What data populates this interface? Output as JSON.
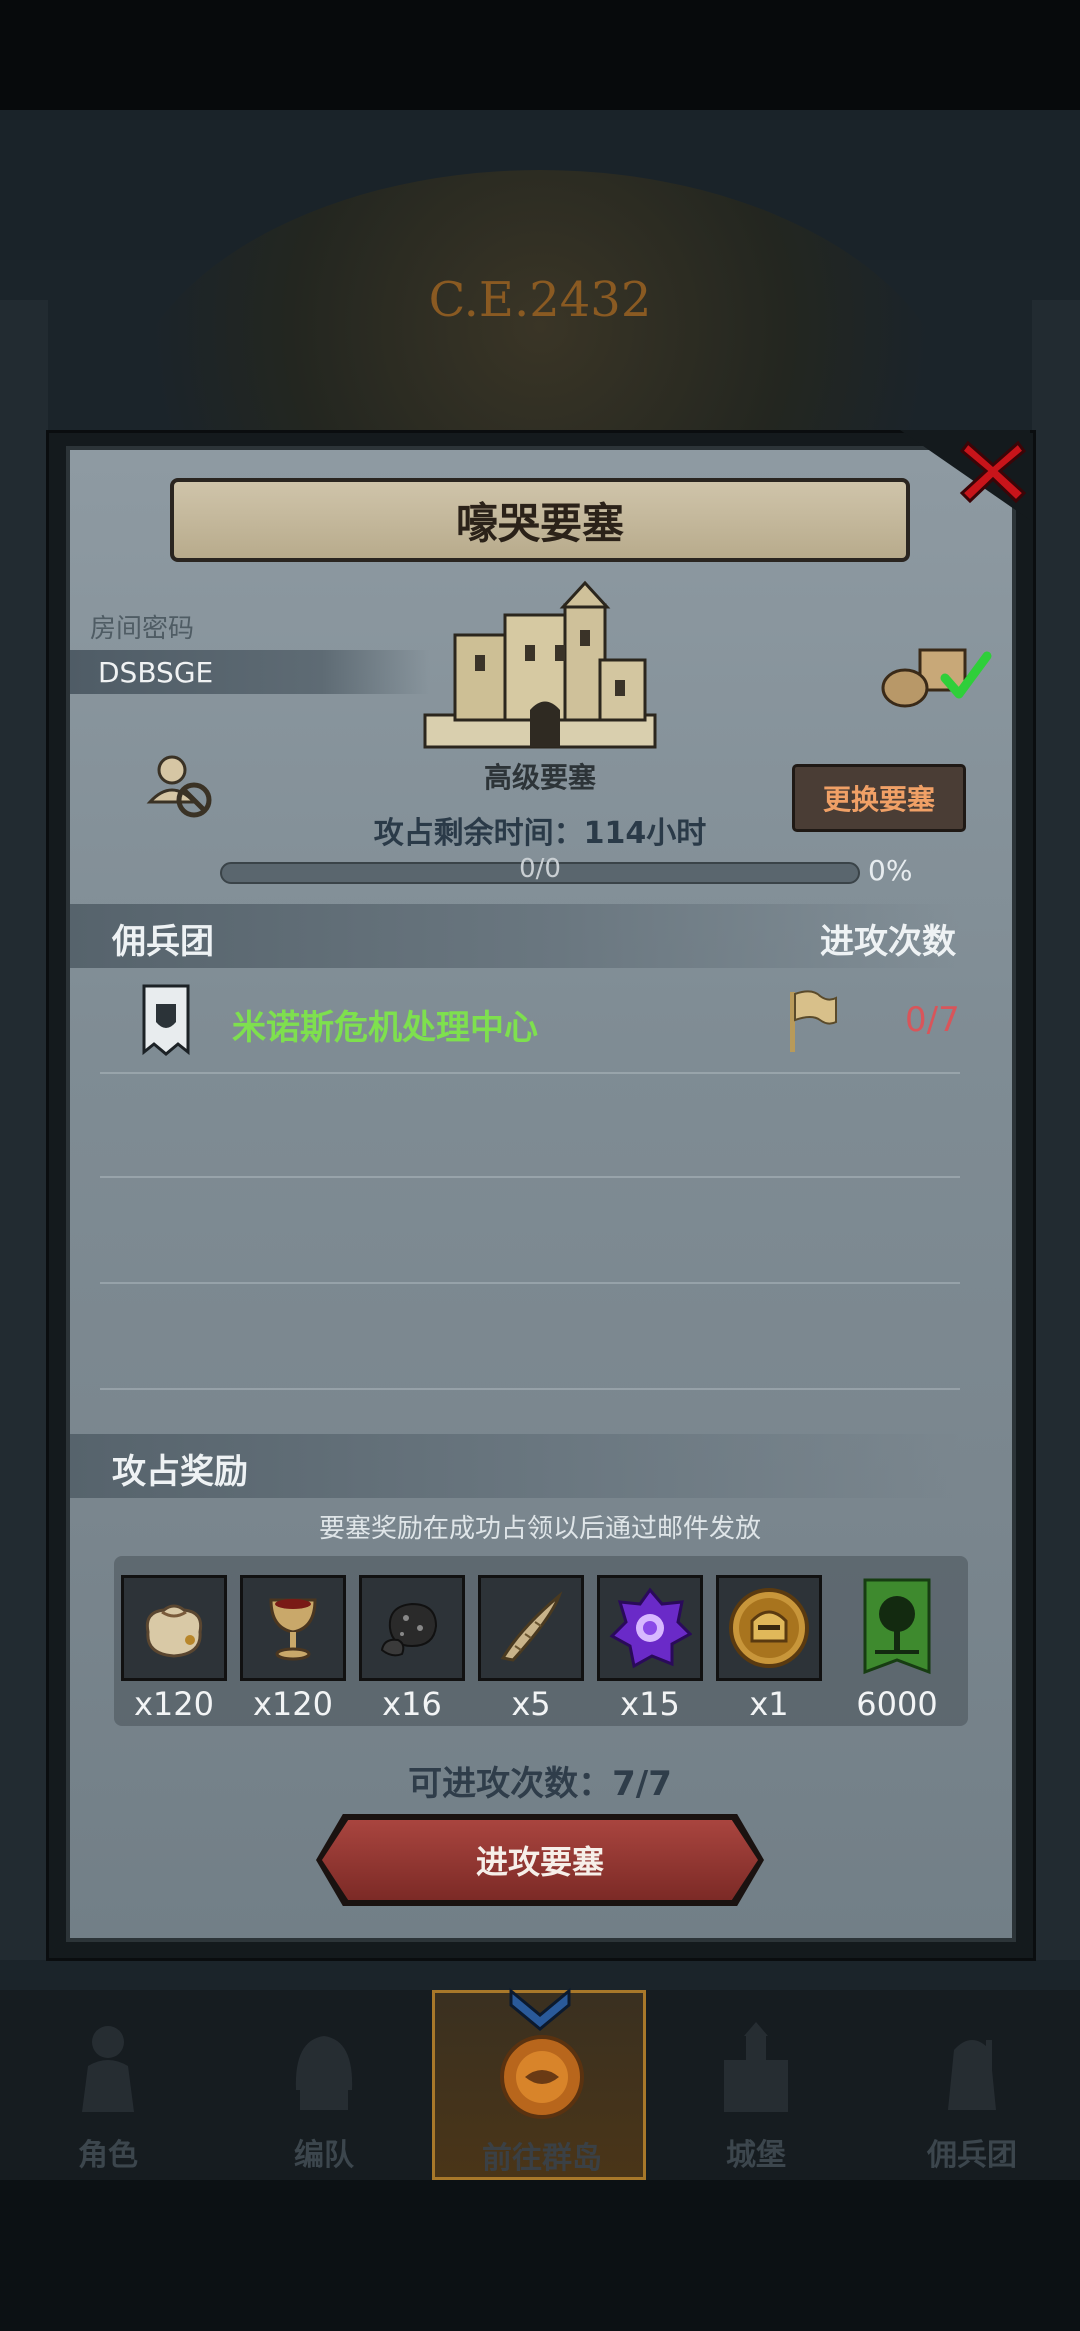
{
  "background": {
    "era_text": "C.E.2432"
  },
  "dialog": {
    "title": "嚎哭要塞",
    "room_password_label": "房间密码",
    "room_password": "DSBSGE",
    "fortress_level": "高级要塞",
    "change_fortress_button": "更换要塞",
    "time_left": "攻占剩余时间：114小时",
    "progress": {
      "text": "0/0",
      "percent_text": "0%",
      "fill_fraction": 0
    },
    "mercenary_section": {
      "title": "佣兵团",
      "attacks_column": "进攻次数"
    },
    "guilds": [
      {
        "name": "米诺斯危机处理中心",
        "attacks": "0/7"
      }
    ],
    "rewards_section": {
      "title": "攻占奖励",
      "note": "要塞奖励在成功占领以后通过邮件发放",
      "items": [
        {
          "icon": "pouch-icon",
          "count": "x120"
        },
        {
          "icon": "goblet-icon",
          "count": "x120"
        },
        {
          "icon": "ore-icon",
          "count": "x16"
        },
        {
          "icon": "horn-icon",
          "count": "x5"
        },
        {
          "icon": "purple-gem-icon",
          "count": "x15"
        },
        {
          "icon": "knight-coin-icon",
          "count": "x1"
        },
        {
          "icon": "tree-banner-icon",
          "count": "6000"
        }
      ]
    },
    "attacks_available": "可进攻次数：7/7",
    "attack_button": "进攻要塞"
  },
  "nav": {
    "items": [
      {
        "label": "角色"
      },
      {
        "label": "编队"
      },
      {
        "label": "前往群岛"
      },
      {
        "label": "城堡"
      },
      {
        "label": "佣兵团"
      }
    ]
  },
  "colors": {
    "guild_name": "#7ee04e",
    "attack_count": "#d8555a",
    "accent_button": "#f0a066"
  }
}
